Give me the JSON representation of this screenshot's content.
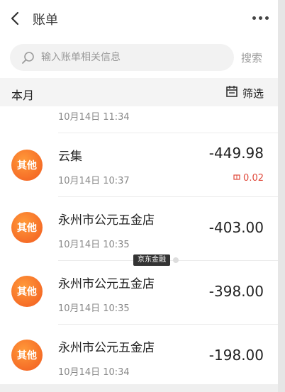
{
  "header": {
    "title": "账单"
  },
  "search": {
    "placeholder": "输入账单相关信息",
    "button": "搜索"
  },
  "month_bar": {
    "label": "本月",
    "filter_label": "筛选"
  },
  "transactions": [
    {
      "category": "",
      "merchant": "",
      "time": "10月14日 11:34",
      "amount": "",
      "discount": ""
    },
    {
      "category": "其他",
      "merchant": "云集",
      "time": "10月14日 10:37",
      "amount": "-449.98",
      "discount": "0.02"
    },
    {
      "category": "其他",
      "merchant": "永州市公元五金店",
      "time": "10月14日 10:35",
      "amount": "-403.00",
      "discount": ""
    },
    {
      "category": "其他",
      "merchant": "永州市公元五金店",
      "time": "10月14日 10:35",
      "amount": "-398.00",
      "discount": ""
    },
    {
      "category": "其他",
      "merchant": "永州市公元五金店",
      "time": "10月14日 10:34",
      "amount": "-198.00",
      "discount": ""
    }
  ],
  "overlay_badge": {
    "label": "京东金融"
  },
  "colors": {
    "accent_orange": "#f25a1f",
    "discount_red": "#e0493b"
  },
  "icons": {
    "back": "chevron-left-icon",
    "more": "more-dots-icon",
    "search": "search-icon",
    "filter": "calendar-filter-icon",
    "discount": "coupon-icon"
  }
}
